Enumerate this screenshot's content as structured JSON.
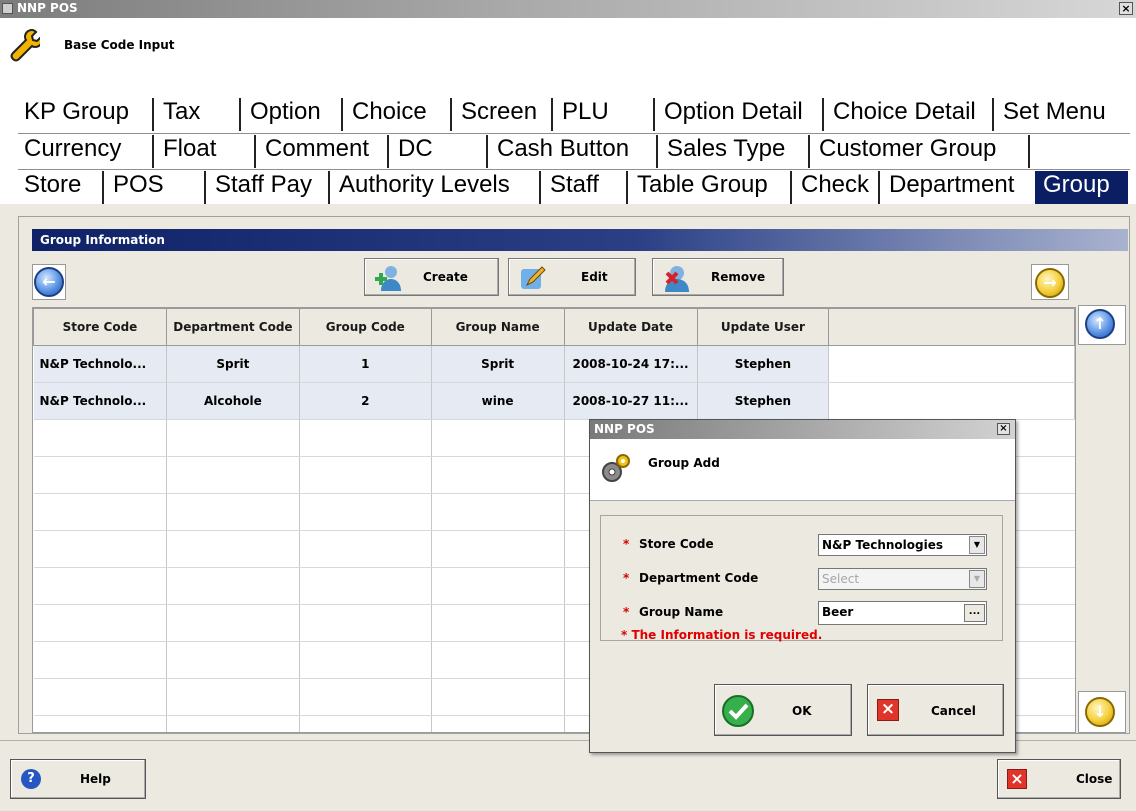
{
  "window": {
    "title": "NNP POS"
  },
  "header": {
    "title": "Base Code Input",
    "icon": "wrench-icon"
  },
  "tabs": {
    "row1": [
      "KP Group",
      "Tax",
      "Option",
      "Choice",
      "Screen",
      "PLU",
      "Option Detail",
      "Choice Detail",
      "Set Menu"
    ],
    "row2": [
      "Currency",
      "Float",
      "Comment",
      "DC",
      "Cash Button",
      "Sales Type",
      "Customer Group"
    ],
    "row3": [
      "Store",
      "POS",
      "Staff Pay",
      "Authority Levels",
      "Staff",
      "Table Group",
      "Check",
      "Department",
      "Group"
    ],
    "active": "Group"
  },
  "section": {
    "title": "Group Information"
  },
  "toolbar": {
    "create": "Create",
    "edit": "Edit",
    "remove": "Remove"
  },
  "table": {
    "headers": [
      "Store Code",
      "Department Code",
      "Group Code",
      "Group Name",
      "Update Date",
      "Update User"
    ],
    "rows": [
      [
        "N&P Technolo...",
        "Sprit",
        "1",
        "Sprit",
        "2008-10-24 17:...",
        "Stephen"
      ],
      [
        "N&P Technolo...",
        "Alcohole",
        "2",
        "wine",
        "2008-10-27 11:...",
        "Stephen"
      ]
    ]
  },
  "footer": {
    "help": "Help",
    "close": "Close"
  },
  "dialog": {
    "title": "NNP POS",
    "heading": "Group Add",
    "store_code_label": "Store Code",
    "store_code_value": "N&P Technologies",
    "department_code_label": "Department Code",
    "department_code_value": "Select",
    "group_name_label": "Group Name",
    "group_name_value": "Beer",
    "required_note": "* The Information is required.",
    "ok": "OK",
    "cancel": "Cancel",
    "star": "*",
    "dots": "..."
  },
  "colors": {
    "tab_active": "#0c1e63",
    "required": "#e00000",
    "section_header": "#0f2267"
  }
}
